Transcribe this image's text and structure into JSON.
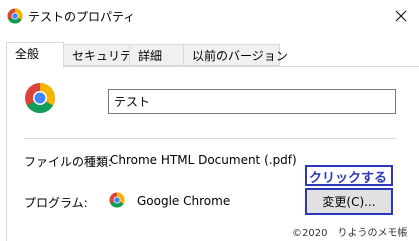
{
  "window": {
    "title": "テストのプロパティ",
    "close_label": "×"
  },
  "tabs": [
    {
      "label": "全般",
      "active": true
    },
    {
      "label": "セキュリティ",
      "active": false
    },
    {
      "label": "詳細",
      "active": false
    },
    {
      "label": "以前のバージョン",
      "active": false
    }
  ],
  "general": {
    "file_name": "テスト",
    "file_type_label": "ファイルの種類:",
    "file_type_value": "Chrome HTML Document (.pdf)",
    "program_label": "プログラム:",
    "program_value": "Google Chrome",
    "change_button_label": "変更(C)..."
  },
  "annotation": {
    "callout": "クリックする",
    "credit": "©2020　りようのメモ帳"
  },
  "colors": {
    "annotation_blue": "#2b38b8",
    "chrome_red": "#db4437",
    "chrome_yellow": "#f4b400",
    "chrome_green": "#0f9d58",
    "chrome_blue": "#4285f4"
  }
}
